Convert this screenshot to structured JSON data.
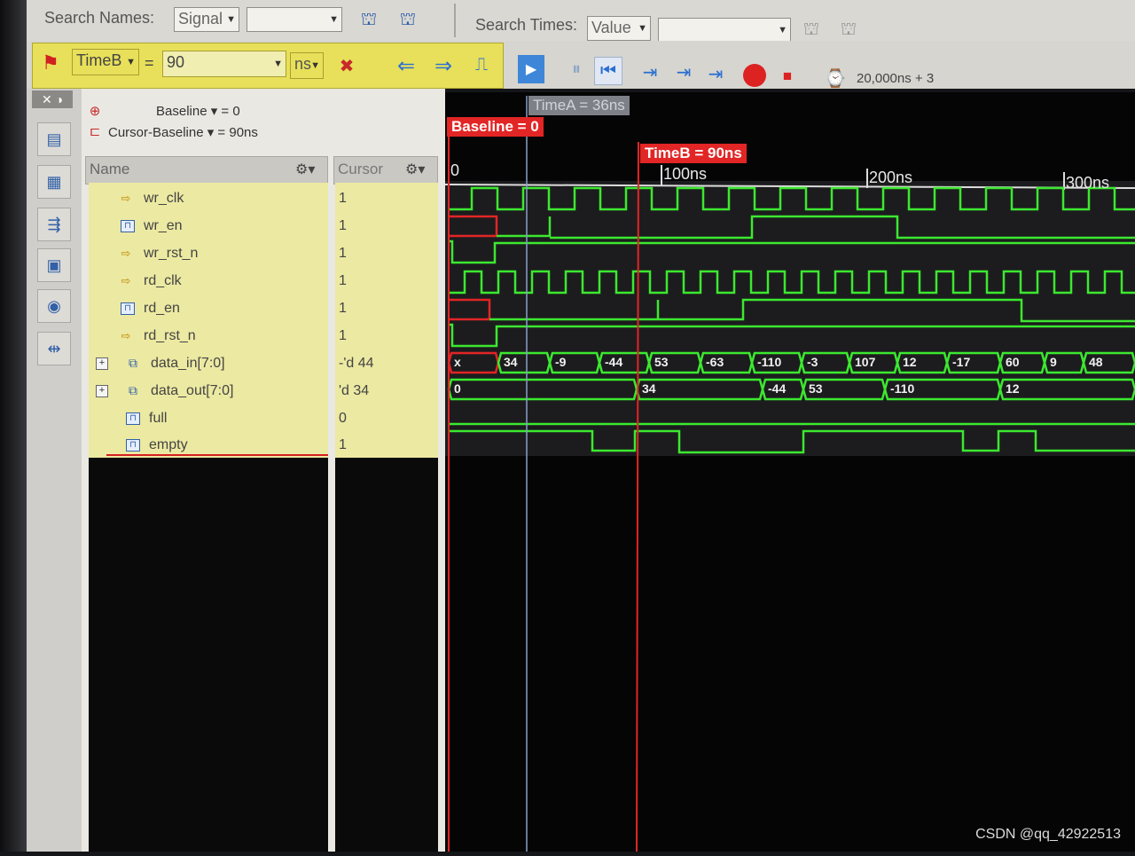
{
  "toolbar1": {
    "search_names_label": "Search Names:",
    "search_names_mode": "Signal",
    "search_names_value": "",
    "search_times_label": "Search Times:",
    "search_times_mode": "Value",
    "search_times_value": ""
  },
  "toolbar2": {
    "marker_select": "TimeB",
    "equals": "=",
    "marker_value": "90",
    "unit": "ns",
    "sim_time": "20,000ns + 3"
  },
  "cursor_info": {
    "baseline_label": "Baseline",
    "baseline_value": "= 0",
    "cursor_baseline_label": "Cursor-Baseline",
    "cursor_baseline_value": "= 90ns"
  },
  "headers": {
    "name": "Name",
    "cursor": "Cursor"
  },
  "signals": [
    {
      "name": "wr_clk",
      "kind": "clock",
      "cursor": "1"
    },
    {
      "name": "wr_en",
      "kind": "wire",
      "cursor": "1"
    },
    {
      "name": "wr_rst_n",
      "kind": "clock",
      "cursor": "1"
    },
    {
      "name": "rd_clk",
      "kind": "clock",
      "cursor": "1"
    },
    {
      "name": "rd_en",
      "kind": "wire",
      "cursor": "1"
    },
    {
      "name": "rd_rst_n",
      "kind": "clock",
      "cursor": "1"
    },
    {
      "name": "data_in[7:0]",
      "kind": "bus",
      "cursor": "-'d 44"
    },
    {
      "name": "data_out[7:0]",
      "kind": "bus",
      "cursor": "'d 34"
    },
    {
      "name": "full",
      "kind": "wire",
      "cursor": "0"
    },
    {
      "name": "empty",
      "kind": "wire",
      "cursor": "1"
    }
  ],
  "markers": {
    "timeA": "TimeA = 36ns",
    "baseline": "Baseline = 0",
    "timeB": "TimeB = 90ns"
  },
  "timescale": {
    "t0": "0",
    "t100": "100ns",
    "t200": "200ns",
    "t300": "300ns"
  },
  "data_in_values": [
    "x",
    "34",
    "-9",
    "-44",
    "53",
    "-63",
    "-110",
    "-3",
    "107",
    "12",
    "-17",
    "60",
    "9",
    "48"
  ],
  "data_out_values": [
    "0",
    "34",
    "-44",
    "53",
    "-110",
    "12"
  ],
  "colors": {
    "wave": "#3ce830",
    "marker": "#e22525",
    "timeA_marker": "#8aa0c8"
  },
  "watermark": "CSDN @qq_42922513"
}
